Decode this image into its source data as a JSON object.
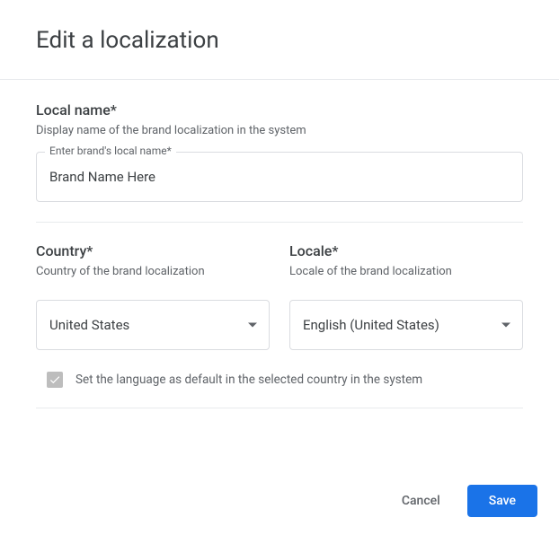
{
  "dialog": {
    "title": "Edit a localization"
  },
  "local_name": {
    "label": "Local name*",
    "hint": "Display name of the brand localization in the system",
    "floating_label": "Enter brand's local name*",
    "value": "Brand Name Here"
  },
  "country": {
    "label": "Country*",
    "hint": "Country of the brand localization",
    "value": "United States"
  },
  "locale": {
    "label": "Locale*",
    "hint": "Locale of the brand localization",
    "value": "English (United States)"
  },
  "default_checkbox": {
    "label": "Set the language as default in the selected country in the system",
    "checked": true
  },
  "actions": {
    "cancel": "Cancel",
    "save": "Save"
  }
}
